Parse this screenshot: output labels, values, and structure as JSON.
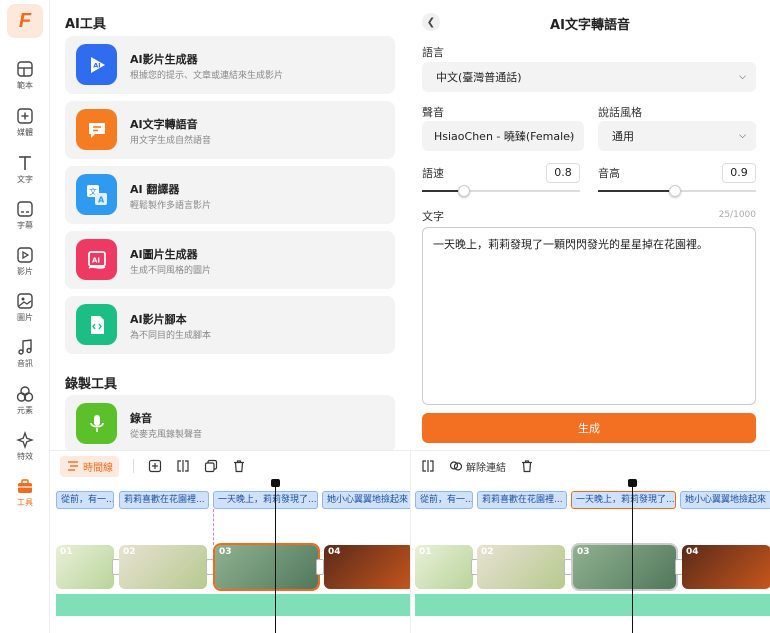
{
  "app": {
    "logo_letter": "F",
    "accent": "#f26a1b"
  },
  "rail": {
    "items": [
      {
        "label": "範本",
        "icon": "layout-icon"
      },
      {
        "label": "媒體",
        "icon": "media-add-icon"
      },
      {
        "label": "文字",
        "icon": "text-icon"
      },
      {
        "label": "字幕",
        "icon": "subtitle-icon"
      },
      {
        "label": "影片",
        "icon": "video-icon"
      },
      {
        "label": "圖片",
        "icon": "image-icon"
      },
      {
        "label": "音訊",
        "icon": "music-icon"
      },
      {
        "label": "元素",
        "icon": "shapes-icon"
      },
      {
        "label": "特效",
        "icon": "sparkle-icon"
      },
      {
        "label": "工具",
        "icon": "toolbox-icon"
      }
    ]
  },
  "tools": {
    "ai_section_title": "AI工具",
    "ai_tools": [
      {
        "title": "AI影片生成器",
        "desc": "根據您的提示、文章或連結來生成影片",
        "color": "#2f6df0"
      },
      {
        "title": "AI文字轉語音",
        "desc": "用文字生成自然語音",
        "color": "#f57c21"
      },
      {
        "title": "AI 翻譯器",
        "desc": "輕鬆製作多語言影片",
        "color": "#2f9bf0"
      },
      {
        "title": "AI圖片生成器",
        "desc": "生成不同風格的圖片",
        "color": "#ee3a62"
      },
      {
        "title": "AI影片腳本",
        "desc": "為不同目的生成腳本",
        "color": "#1bbf86"
      }
    ],
    "record_section_title": "錄製工具",
    "record_tools": [
      {
        "title": "錄音",
        "desc": "從麥克風錄製聲音",
        "color": "#5cc02a"
      }
    ]
  },
  "tts": {
    "title": "AI文字轉語音",
    "language_label": "語言",
    "language_value": "中文(臺灣普通話)",
    "voice_label": "聲音",
    "voice_value": "HsiaoChen - 曉臻(Female)",
    "style_label": "說話風格",
    "style_value": "通用",
    "speed_label": "語速",
    "speed_value": "0.8",
    "pitch_label": "音高",
    "pitch_value": "0.9",
    "text_label": "文字",
    "char_count": "25/1000",
    "text_value": "一天晚上，莉莉發現了一顆閃閃發光的星星掉在花園裡。",
    "generate_label": "生成"
  },
  "timeline_left": {
    "timeline_label": "時間線",
    "subtitles": [
      "從前，有一...",
      "莉莉喜歡在花園裡...",
      "一天晚上，莉莉發現了...",
      "她小心翼翼地撿起來"
    ],
    "clips": [
      "01",
      "02",
      "03",
      "04"
    ]
  },
  "timeline_right": {
    "unlink_label": "解除連結",
    "subtitles": [
      "從前，有一...",
      "莉莉喜歡在花園裡...",
      "一天晚上，莉莉發現了...",
      "她小心翼翼地撿起來"
    ],
    "clips": [
      "01",
      "02",
      "03",
      "04"
    ]
  }
}
